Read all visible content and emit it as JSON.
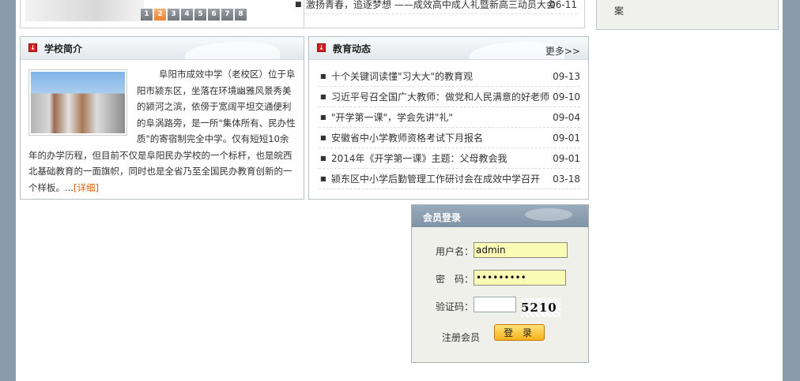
{
  "slider": {
    "pages": [
      "1",
      "2",
      "3",
      "4",
      "5",
      "6",
      "7",
      "8"
    ],
    "active_index": 1
  },
  "top_news": {
    "title": "激扬青春，追逐梦想 ——成效高中成人礼暨新高三动员大会",
    "date": "06-11"
  },
  "right_box": {
    "text": "案"
  },
  "intro": {
    "title": "学校简介",
    "text": "阜阳市成效中学（老校区）位于阜阳市颍东区，坐落在环境幽雅风景秀美的颍河之滨，依傍于宽阔平坦交通便利的阜涡路旁，是一所\"集体所有、民办性质\"的寄宿制完全中学。仅有短短10余年的办学历程，但目前不仅是阜阳民办学校的一个标杆，也是皖西北基础教育的一面旗帜，同时也是全省乃至全国民办教育创新的一个样板。...",
    "more_link": "[详细]"
  },
  "news": {
    "title": "教育动态",
    "more": "更多>>",
    "items": [
      {
        "title": "十个关键词读懂\"习大大\"的教育观",
        "date": "09-13"
      },
      {
        "title": "习近平号召全国广大教师：做党和人民满意的好老师",
        "date": "09-10"
      },
      {
        "title": "\"开学第一课\"，学会先讲\"礼\"",
        "date": "09-04"
      },
      {
        "title": "安徽省中小学教师资格考试下月报名",
        "date": "09-01"
      },
      {
        "title": "2014年《开学第一课》主题：父母教会我",
        "date": "09-01"
      },
      {
        "title": "颍东区中小学后勤管理工作研讨会在成效中学召开",
        "date": "03-18"
      }
    ]
  },
  "login": {
    "title": "会员登录",
    "username_label": "用户名：",
    "username_value": "admin",
    "password_label": "密　码：",
    "password_value": "123456789",
    "captcha_label": "验证码：",
    "captcha_value": "",
    "captcha_text": "5210",
    "register_label": "注册会员",
    "login_button": "登 录"
  },
  "colors": {
    "accent_orange": "#ef7f2a",
    "link_orange": "#e06010",
    "input_yellow": "#fbfbb6",
    "login_header": "#8a9cb0"
  }
}
